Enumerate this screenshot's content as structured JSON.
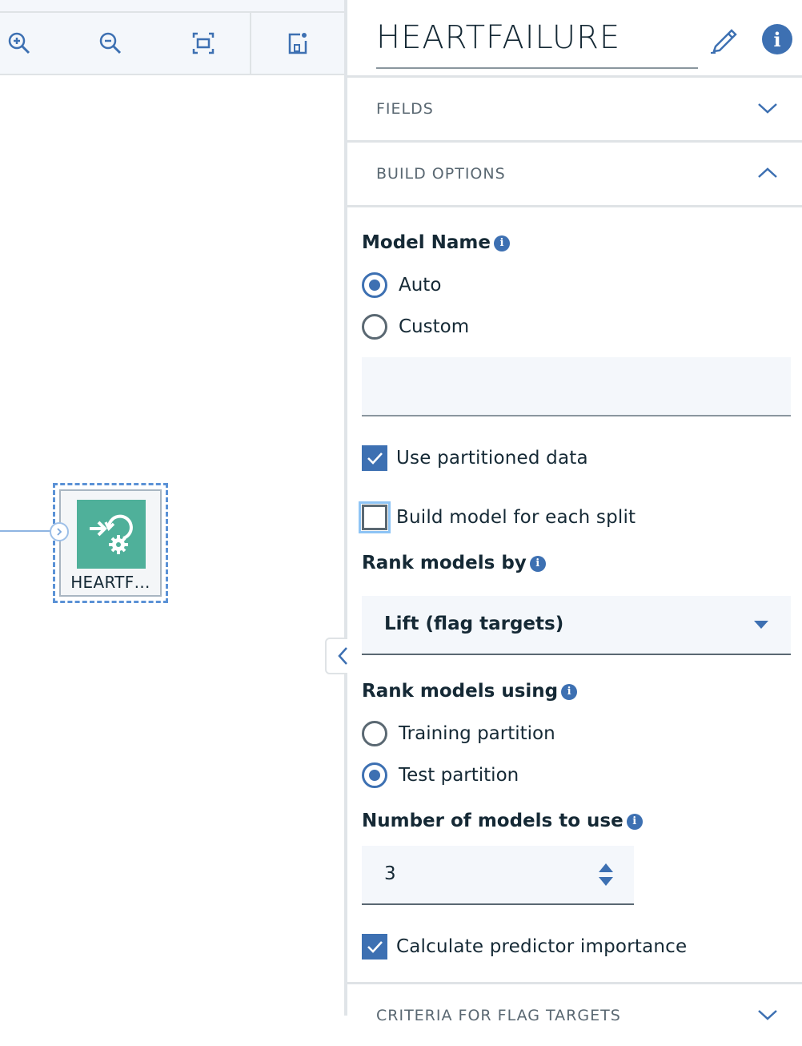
{
  "canvas": {
    "toolbar": {
      "zoom_in_icon": "zoom-in-icon",
      "zoom_out_icon": "zoom-out-icon",
      "fit_icon": "fit-to-screen-icon",
      "minimap_icon": "minimap-icon"
    },
    "node": {
      "label": "HEARTF…",
      "icon": "auto-classifier-icon",
      "color": "#4fb09a"
    },
    "collapse_icon": "chevron-left-icon"
  },
  "panel": {
    "title": "HEARTFAILURE",
    "edit_icon": "pencil-icon",
    "info_icon": "info-icon",
    "sections": {
      "fields": {
        "label": "FIELDS",
        "expanded": false
      },
      "build_options": {
        "label": "BUILD OPTIONS",
        "expanded": true
      },
      "criteria": {
        "label": "CRITERIA FOR FLAG TARGETS",
        "expanded": false
      }
    },
    "build": {
      "model_name": {
        "label": "Model Name",
        "options": [
          "Auto",
          "Custom"
        ],
        "selected": "Auto",
        "custom_value": ""
      },
      "use_partitioned": {
        "label": "Use partitioned data",
        "checked": true
      },
      "build_each_split": {
        "label": "Build model for each split",
        "checked": false
      },
      "rank_by": {
        "label": "Rank models by",
        "value": "Lift (flag targets)"
      },
      "rank_using": {
        "label": "Rank models using",
        "options": [
          "Training partition",
          "Test partition"
        ],
        "selected": "Test partition"
      },
      "num_models": {
        "label": "Number of models to use",
        "value": "3"
      },
      "predictor_importance": {
        "label": "Calculate predictor importance",
        "checked": true
      }
    },
    "accent": "#3d70b2"
  }
}
